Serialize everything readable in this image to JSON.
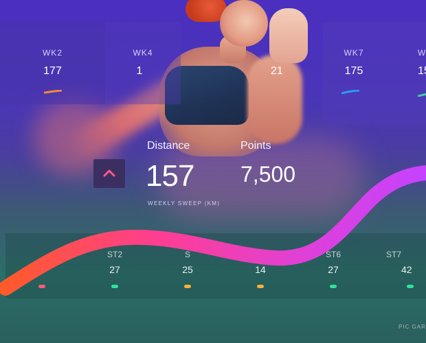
{
  "top_cards": [
    {
      "week": "WK2",
      "value": "177",
      "mark_color": "#f08a3a"
    },
    {
      "week": "WK4",
      "value": "1",
      "mark_color": "#f5a442"
    },
    {
      "week": "WK7",
      "value": "175",
      "mark_color": "#2a9df6"
    },
    {
      "week": "W",
      "value": "15",
      "mark_color": "#3dd3a0"
    }
  ],
  "occluded_card_value": "21",
  "distance": {
    "label": "Distance",
    "value": "157",
    "caption": "WEEKLY SWEEP (KM)"
  },
  "points": {
    "label": "Points",
    "value": "7,500"
  },
  "bottom_cards": [
    {
      "label": "",
      "value": "",
      "bar_color": "#ff5a7a"
    },
    {
      "label": "ST2",
      "value": "27",
      "bar_color": "#2ee29a"
    },
    {
      "label": "S",
      "value": "25",
      "bar_color": "#f5b13a"
    },
    {
      "label": "",
      "value": "14",
      "bar_color": "#f5b13a"
    },
    {
      "label": "ST6",
      "value": "27",
      "bar_color": "#2ee29a"
    },
    {
      "label": "ST7",
      "value": "42",
      "bar_color": "#2ee29a"
    }
  ],
  "chevron": {
    "icon": "chevron-up-icon",
    "color": "#ff5a84"
  },
  "curve": {
    "gradient": [
      "#ff5a2a",
      "#ff3e8f",
      "#e040d6",
      "#c542ff"
    ]
  },
  "credit": "PIC GAR"
}
